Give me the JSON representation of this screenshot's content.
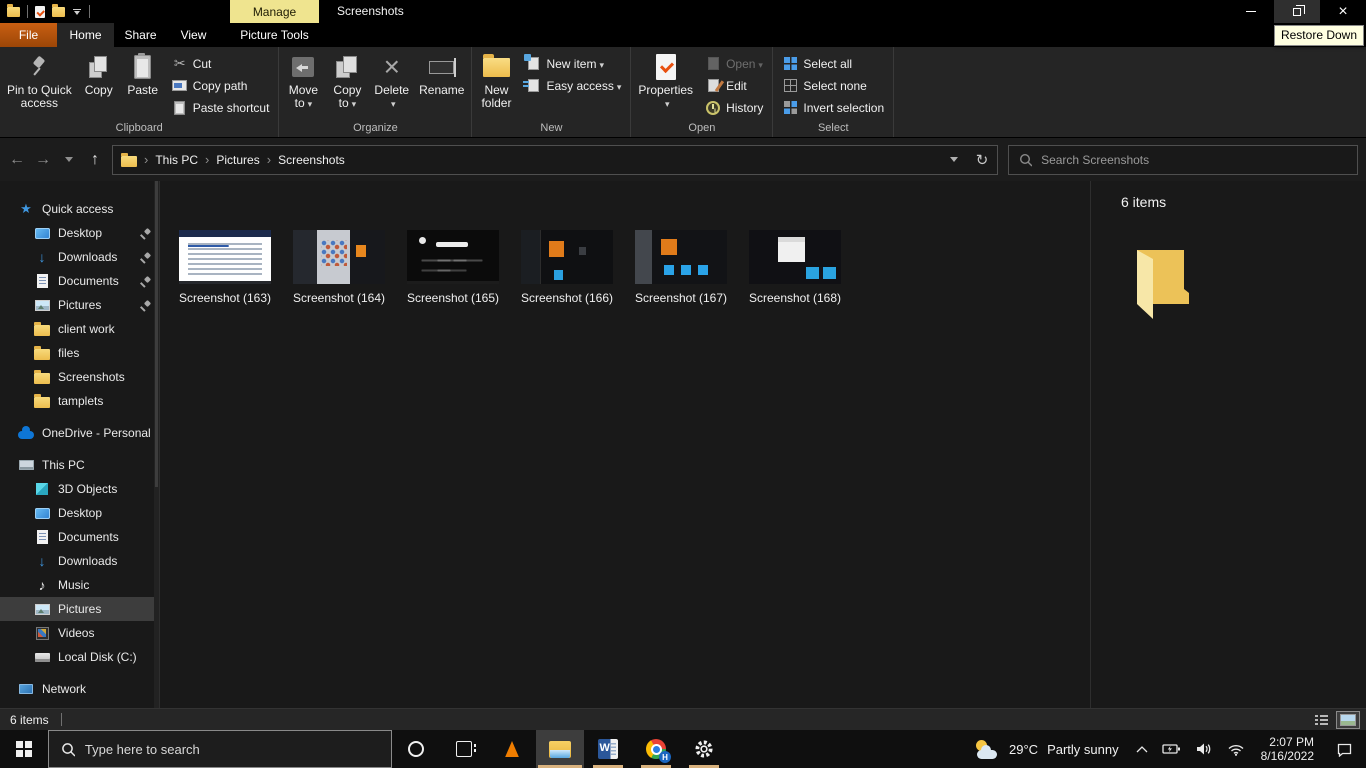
{
  "window": {
    "title": "Screenshots",
    "contextual_header": "Manage",
    "tooltip": "Restore Down"
  },
  "qat": {
    "icons": [
      "folder-icon",
      "properties-icon",
      "folder-icon",
      "customize-caret-icon"
    ]
  },
  "ribbon": {
    "tabs": {
      "file": "File",
      "home": "Home",
      "share": "Share",
      "view": "View",
      "picture_tools": "Picture Tools"
    },
    "clipboard": {
      "label": "Clipboard",
      "pin": {
        "line1": "Pin to Quick",
        "line2": "access"
      },
      "copy": "Copy",
      "paste": "Paste",
      "cut": "Cut",
      "copy_path": "Copy path",
      "paste_shortcut": "Paste shortcut"
    },
    "organize": {
      "label": "Organize",
      "move_to": {
        "line1": "Move",
        "line2": "to"
      },
      "copy_to": {
        "line1": "Copy",
        "line2": "to"
      },
      "delete": "Delete",
      "rename": "Rename"
    },
    "new": {
      "label": "New",
      "new_folder": {
        "line1": "New",
        "line2": "folder"
      },
      "new_item": "New item",
      "easy_access": "Easy access"
    },
    "open": {
      "label": "Open",
      "properties": "Properties",
      "open": "Open",
      "edit": "Edit",
      "history": "History"
    },
    "select": {
      "label": "Select",
      "select_all": "Select all",
      "select_none": "Select none",
      "invert_selection": "Invert selection"
    }
  },
  "navbar": {
    "breadcrumb": [
      "This PC",
      "Pictures",
      "Screenshots"
    ],
    "search_placeholder": "Search Screenshots"
  },
  "sidebar": {
    "sections": [
      {
        "label": "Quick access",
        "icon": "quick-access-star-icon",
        "items": [
          {
            "label": "Desktop",
            "icon": "desktop-icon",
            "pinned": true
          },
          {
            "label": "Downloads",
            "icon": "downloads-icon",
            "pinned": true
          },
          {
            "label": "Documents",
            "icon": "documents-icon",
            "pinned": true
          },
          {
            "label": "Pictures",
            "icon": "pictures-icon",
            "pinned": true
          },
          {
            "label": "client work",
            "icon": "folder-icon"
          },
          {
            "label": "files",
            "icon": "folder-icon"
          },
          {
            "label": "Screenshots",
            "icon": "folder-icon"
          },
          {
            "label": "tamplets",
            "icon": "folder-icon"
          }
        ]
      },
      {
        "label": "OneDrive - Personal",
        "icon": "onedrive-cloud-icon",
        "items": []
      },
      {
        "label": "This PC",
        "icon": "this-pc-icon",
        "items": [
          {
            "label": "3D Objects",
            "icon": "3d-objects-icon"
          },
          {
            "label": "Desktop",
            "icon": "desktop-icon"
          },
          {
            "label": "Documents",
            "icon": "documents-icon"
          },
          {
            "label": "Downloads",
            "icon": "downloads-icon"
          },
          {
            "label": "Music",
            "icon": "music-icon"
          },
          {
            "label": "Pictures",
            "icon": "pictures-icon",
            "selected": true
          },
          {
            "label": "Videos",
            "icon": "videos-icon"
          },
          {
            "label": "Local Disk (C:)",
            "icon": "disk-icon"
          }
        ]
      },
      {
        "label": "Network",
        "icon": "network-icon",
        "items": []
      }
    ]
  },
  "content": {
    "files": [
      {
        "name": "Screenshot (163)",
        "variant": "word-document"
      },
      {
        "name": "Screenshot (164)",
        "variant": "mixed-light-dark-window"
      },
      {
        "name": "Screenshot (165)",
        "variant": "dark-landing-page"
      },
      {
        "name": "Screenshot (166)",
        "variant": "dark-app-orange-panel"
      },
      {
        "name": "Screenshot (167)",
        "variant": "dark-app-blue-tiles"
      },
      {
        "name": "Screenshot (168)",
        "variant": "dialog-over-dark-app"
      }
    ]
  },
  "preview": {
    "header": "6 items"
  },
  "statusbar": {
    "items": "6 items"
  },
  "taskbar": {
    "search_placeholder": "Type here to search",
    "pinned": [
      "vlc",
      "file-explorer",
      "word",
      "chrome",
      "settings"
    ],
    "chrome_badge": "H",
    "weather": {
      "temp": "29°C",
      "condition": "Partly sunny"
    },
    "clock": {
      "time": "2:07 PM",
      "date": "8/16/2022"
    }
  },
  "colors": {
    "file_tab_orange": "#bb540d",
    "contextual_tab_yellow": "#efe48f",
    "folder_yellow": "#f0c75a",
    "taskbar_underline_tan": "#d9b27e",
    "selection_gray": "#3d3d3d",
    "tooltip_bg": "#ffffe1"
  }
}
